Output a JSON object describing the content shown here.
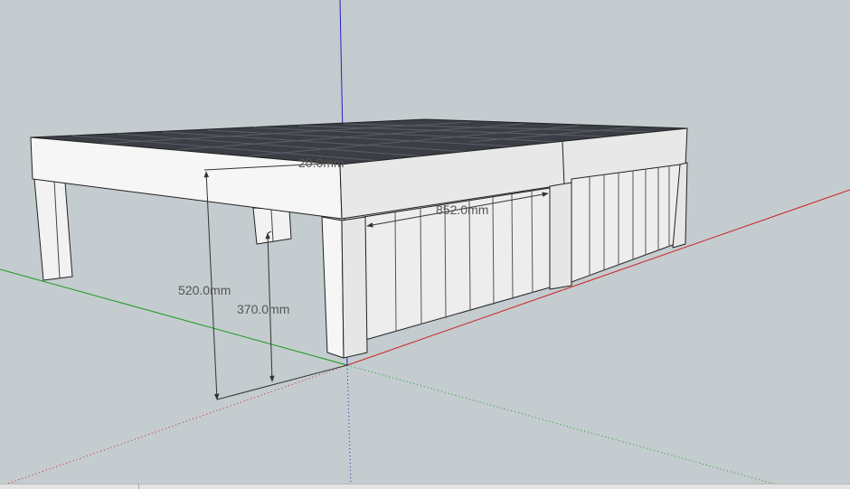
{
  "viewport": {
    "background": "#c4cccf",
    "axis_colors": {
      "red": "#cc2222",
      "green": "#1a9a1a",
      "blue": "#2222cc"
    }
  },
  "model": {
    "dimensions": [
      {
        "id": "top-thickness",
        "label": "20.0mm"
      },
      {
        "id": "drawer-width",
        "label": "852.0mm"
      },
      {
        "id": "total-height",
        "label": "520.0mm"
      },
      {
        "id": "drawer-height",
        "label": "370.0mm"
      }
    ]
  }
}
